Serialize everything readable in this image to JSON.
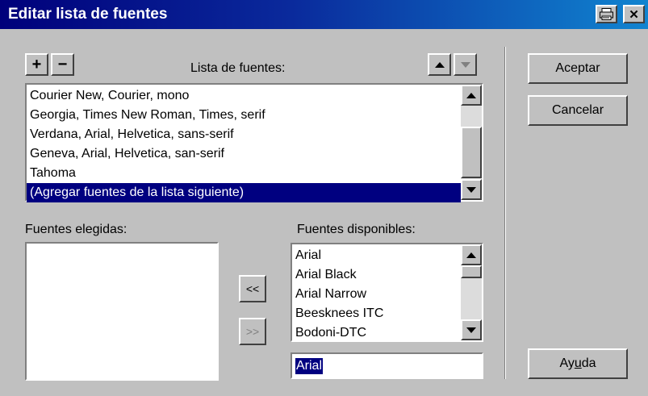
{
  "window": {
    "title": "Editar lista de fuentes",
    "print_icon": "printer-icon",
    "close_glyph": "✕"
  },
  "toolbar": {
    "add_label": "+",
    "remove_label": "−",
    "up_icon": "arrow-up-icon",
    "down_icon": "arrow-down-icon"
  },
  "font_list": {
    "label": "Lista de fuentes:",
    "items": [
      "Courier New, Courier, mono",
      "Georgia, Times New Roman, Times, serif",
      "Verdana, Arial, Helvetica, sans-serif",
      "Geneva, Arial, Helvetica, san-serif",
      "Tahoma",
      "(Agregar fuentes de la lista siguiente)"
    ],
    "selected_index": 5
  },
  "chosen": {
    "label": "Fuentes elegidas:",
    "items": []
  },
  "available": {
    "label": "Fuentes disponibles:",
    "items": [
      "Arial",
      "Arial Black",
      "Arial Narrow",
      "Beesknees ITC",
      "Bodoni-DTC"
    ],
    "input_value": "Arial"
  },
  "transfer": {
    "add_label": "<<",
    "remove_label": ">>"
  },
  "buttons": {
    "ok": "Aceptar",
    "cancel": "Cancelar",
    "help_prefix": "Ay",
    "help_mnemonic": "u",
    "help_suffix": "da"
  }
}
